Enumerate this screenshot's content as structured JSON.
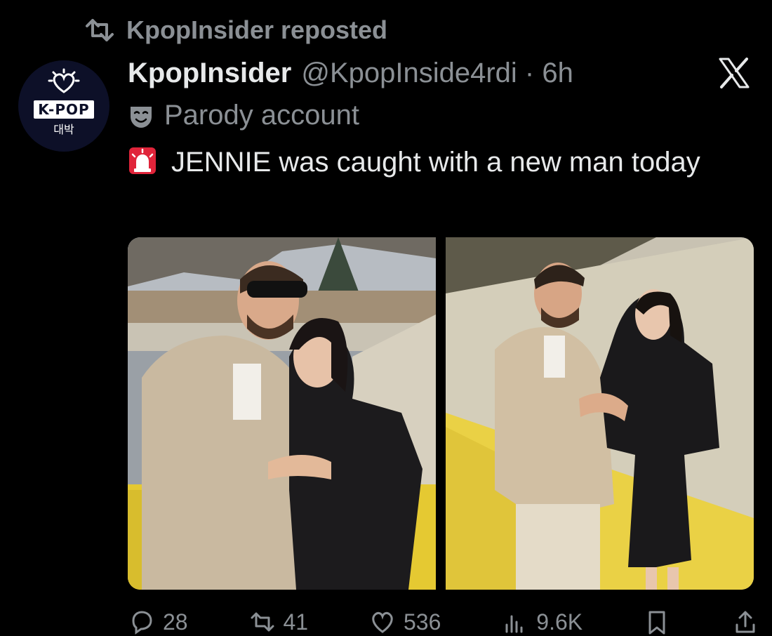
{
  "repost": {
    "label": "KpopInsider reposted"
  },
  "author": {
    "display_name": "KpopInsider",
    "handle_time": "@KpopInside4rdi · 6h",
    "avatar_badge": "K-POP",
    "avatar_korean": "대박"
  },
  "parody": {
    "label": "Parody account"
  },
  "tweet": {
    "text_after_emoji": "JENNIE was caught with a new man today"
  },
  "media": {
    "photos": [
      "photo-left",
      "photo-right"
    ]
  },
  "actions": {
    "replies": "28",
    "reposts": "41",
    "likes": "536",
    "views": "9.6K"
  },
  "icons": {
    "repost": "repost-icon",
    "x_logo": "x-logo-icon",
    "parody": "theater-mask-icon",
    "siren": "siren-icon",
    "reply": "reply-icon",
    "like": "heart-icon",
    "views": "views-icon",
    "bookmark": "bookmark-icon",
    "share": "share-icon"
  },
  "colors": {
    "background": "#000000",
    "text": "#e7e9ea",
    "secondary": "#8b9095",
    "siren": "#e0243a"
  }
}
